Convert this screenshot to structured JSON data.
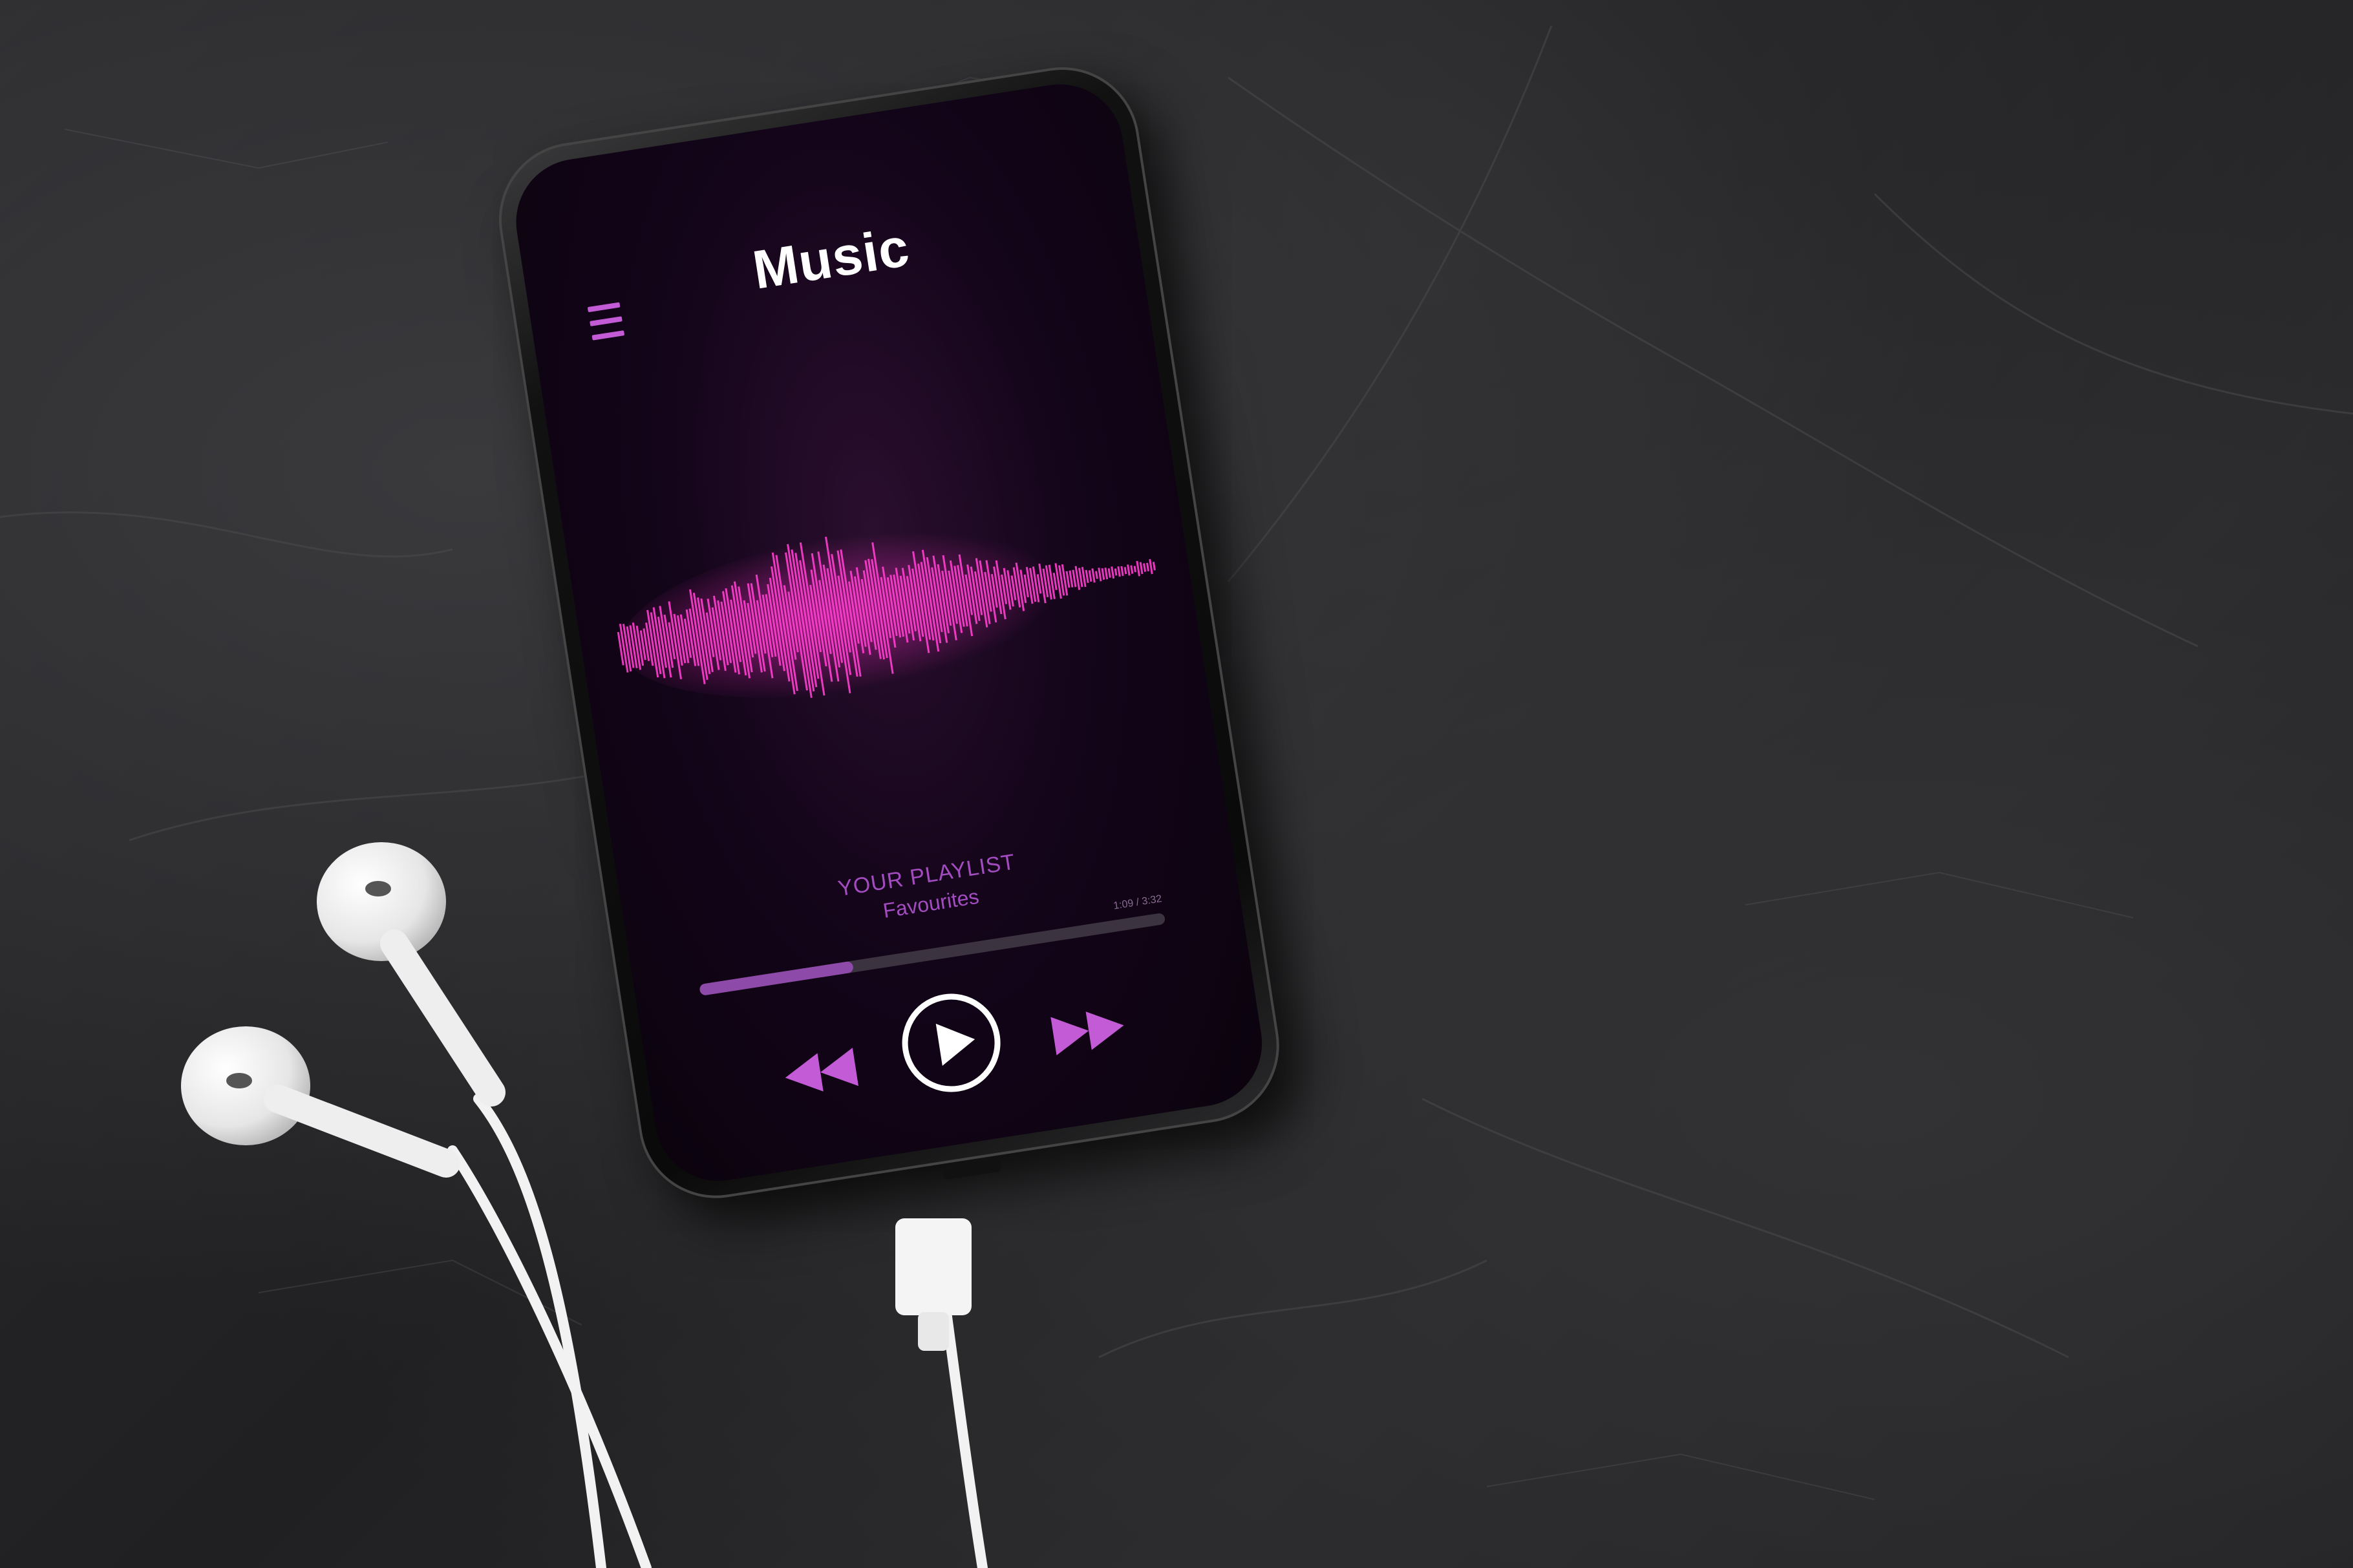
{
  "app": {
    "title": "Music"
  },
  "icons": {
    "menu": "hamburger-menu-icon",
    "rewind": "rewind-icon",
    "play": "play-icon",
    "forward": "fast-forward-icon"
  },
  "now_playing": {
    "playlist_label": "YOUR PLAYLIST",
    "playlist_name": "Favourites",
    "time": "1:09 / 3:32",
    "progress": 0.33
  },
  "colors": {
    "accent": "#c35bd6",
    "waveform": "#e040d8",
    "background": "#1e1e20"
  }
}
